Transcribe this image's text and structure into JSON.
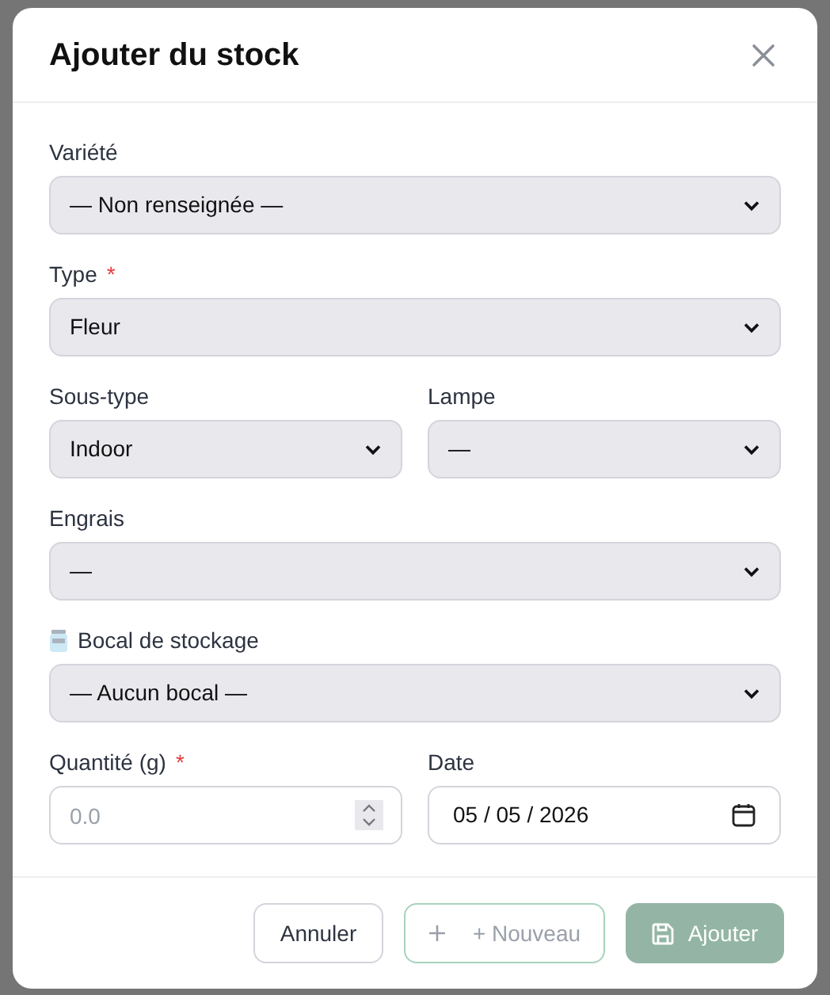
{
  "dialog": {
    "title": "Ajouter du stock",
    "rows": [
      [
        {
          "kind": "select",
          "label": "Variété",
          "value": "— Non renseignée —"
        }
      ],
      [
        {
          "kind": "select",
          "label": "Type",
          "required_mark": "*",
          "value": "Fleur"
        }
      ],
      [
        {
          "kind": "select",
          "label": "Sous-type",
          "value": "Indoor"
        },
        {
          "kind": "select",
          "label": "Lampe",
          "value": "—"
        }
      ],
      [
        {
          "kind": "select",
          "label": "Engrais",
          "value": "—"
        }
      ],
      [
        {
          "kind": "select",
          "label": "Bocal de stockage",
          "has_icon": true,
          "value": "— Aucun bocal —"
        }
      ],
      [
        {
          "kind": "number",
          "label": "Quantité (g)",
          "required_mark": "*",
          "placeholder": "0.0"
        },
        {
          "kind": "date",
          "label": "Date",
          "value": "05 / 05 / 2026"
        }
      ]
    ],
    "buttons": [
      {
        "kind": "cancel",
        "label": "Annuler",
        "disabled": false
      },
      {
        "kind": "new",
        "label": "+ Nouveau",
        "disabled": true
      },
      {
        "kind": "submit",
        "label": "Ajouter",
        "disabled": true
      }
    ]
  }
}
